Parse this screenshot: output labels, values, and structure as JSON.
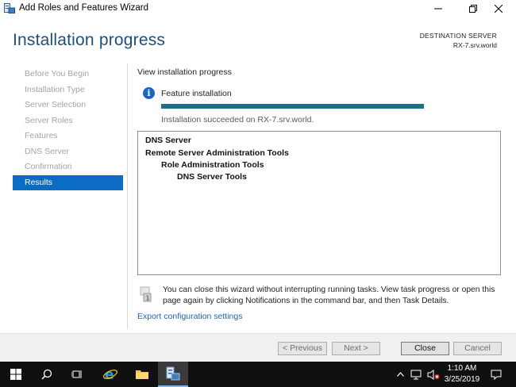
{
  "window": {
    "title": "Add Roles and Features Wizard",
    "icon": "server-manager-icon"
  },
  "header": {
    "page_title": "Installation progress",
    "destination_label": "DESTINATION SERVER",
    "destination_value": "RX-7.srv.world"
  },
  "nav": {
    "items": [
      {
        "label": "Before You Begin",
        "active": false
      },
      {
        "label": "Installation Type",
        "active": false
      },
      {
        "label": "Server Selection",
        "active": false
      },
      {
        "label": "Server Roles",
        "active": false
      },
      {
        "label": "Features",
        "active": false
      },
      {
        "label": "DNS Server",
        "active": false
      },
      {
        "label": "Confirmation",
        "active": false
      },
      {
        "label": "Results",
        "active": true
      }
    ]
  },
  "main": {
    "section_title": "View installation progress",
    "feature_label": "Feature installation",
    "progress": 1.0,
    "status_text": "Installation succeeded on RX-7.srv.world.",
    "results": [
      {
        "text": "DNS Server",
        "level": 0
      },
      {
        "text": "Remote Server Administration Tools",
        "level": 0
      },
      {
        "text": "Role Administration Tools",
        "level": 1
      },
      {
        "text": "DNS Server Tools",
        "level": 2
      }
    ],
    "note_text": "You can close this wizard without interrupting running tasks. View task progress or open this page again by clicking Notifications in the command bar, and then Task Details.",
    "export_link": "Export configuration settings"
  },
  "buttons": {
    "previous": "< Previous",
    "next": "Next >",
    "close": "Close",
    "cancel": "Cancel"
  },
  "taskbar": {
    "time": "1:10 AM",
    "date": "3/25/2019"
  },
  "colors": {
    "accent": "#0c6bc3",
    "title": "#1f4e79",
    "progress": "#1c6f87",
    "link": "#1c64c4"
  }
}
